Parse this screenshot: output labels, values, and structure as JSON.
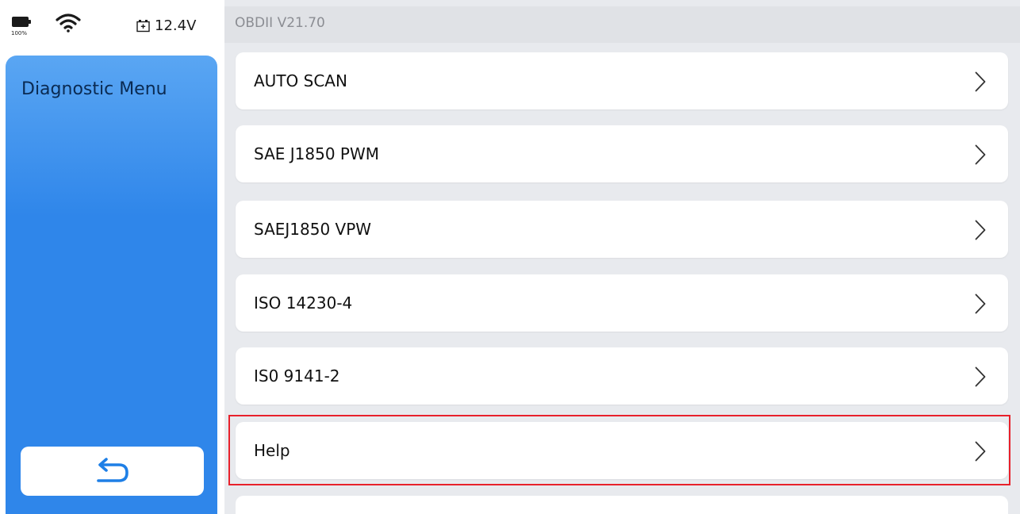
{
  "status": {
    "battery_percent": "100%",
    "voltage": "12.4V",
    "battery_icon": "battery-icon",
    "wifi_icon": "wifi-icon",
    "voltage_icon": "car-battery-icon"
  },
  "sidebar": {
    "title": "Diagnostic Menu",
    "back_icon": "back-arrow-icon"
  },
  "header": {
    "version": "OBDII V21.70"
  },
  "menu": {
    "items": [
      {
        "label": "AUTO SCAN"
      },
      {
        "label": "SAE J1850 PWM"
      },
      {
        "label": "SAEJ1850 VPW"
      },
      {
        "label": "ISO 14230-4"
      },
      {
        "label": "IS0 9141-2"
      },
      {
        "label": "Help",
        "highlighted": true
      }
    ]
  },
  "colors": {
    "sidebar_blue": "#2f86ea",
    "highlight_red": "#e8212b",
    "back_arrow_blue": "#1e7fe6"
  }
}
